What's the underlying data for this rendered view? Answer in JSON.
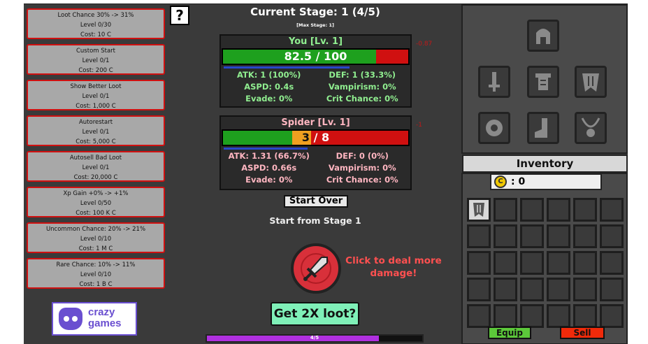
{
  "upgrades": [
    {
      "name": "Loot Chance 30% -> 31%",
      "level": "Level 0/30",
      "cost": "Cost: 10 C"
    },
    {
      "name": "Custom Start",
      "level": "Level 0/1",
      "cost": "Cost: 200 C"
    },
    {
      "name": "Show Better Loot",
      "level": "Level 0/1",
      "cost": "Cost: 1,000 C"
    },
    {
      "name": "Autorestart",
      "level": "Level 0/1",
      "cost": "Cost: 5,000 C"
    },
    {
      "name": "Autosell Bad Loot",
      "level": "Level 0/1",
      "cost": "Cost: 20,000 C"
    },
    {
      "name": "Xp Gain +0% -> +1%",
      "level": "Level 0/50",
      "cost": "Cost: 100 K C"
    },
    {
      "name": "Uncommon Chance: 20% -> 21%",
      "level": "Level 0/10",
      "cost": "Cost: 1 M C"
    },
    {
      "name": "Rare Chance: 10% -> 11%",
      "level": "Level 0/10",
      "cost": "Cost: 1 B C"
    }
  ],
  "help_label": "?",
  "logo": {
    "line1": "crazy",
    "line2": "games"
  },
  "stage": {
    "title": "Current Stage: 1 (4/5)",
    "max": "[Max Stage: 1]"
  },
  "player": {
    "name": "You [Lv. 1]",
    "hp_text": "82.5 / 100",
    "hp_fraction": 0.825,
    "damage_popup": "-0.87",
    "atk": "ATK: 1 (100%)",
    "def": "DEF: 1 (33.3%)",
    "aspd": "ASPD: 0.4s",
    "vamp": "Vampirism: 0%",
    "evade": "Evade: 0%",
    "crit": "Crit Chance: 0%"
  },
  "enemy": {
    "name": "Spider [Lv. 1]",
    "hp_current": "3",
    "hp_sep": " / ",
    "hp_max": "8",
    "damage_popup": "-1",
    "atk": "ATK: 1.31 (66.7%)",
    "def": "DEF: 0 (0%)",
    "aspd": "ASPD: 0.66s",
    "vamp": "Vampirism: 0%",
    "evade": "Evade: 0%",
    "crit": "Crit Chance: 0%"
  },
  "start_over_label": "Start Over",
  "start_from_label": "Start from Stage 1",
  "click_message": "Click to deal more damage!",
  "loot_button_label": "Get 2X loot?",
  "progress": {
    "text": "4/5",
    "fraction": 0.8
  },
  "inventory": {
    "title": "Inventory",
    "coin_symbol": "C",
    "coins": ": 0"
  },
  "equip_label": "Equip",
  "sell_label": "Sell",
  "colors": {
    "hp_green": "#1ea01e",
    "hp_red": "#d01010",
    "player_name": "#90ee90",
    "enemy_name": "#ffb6c1",
    "accent_purple": "#b030e0"
  }
}
